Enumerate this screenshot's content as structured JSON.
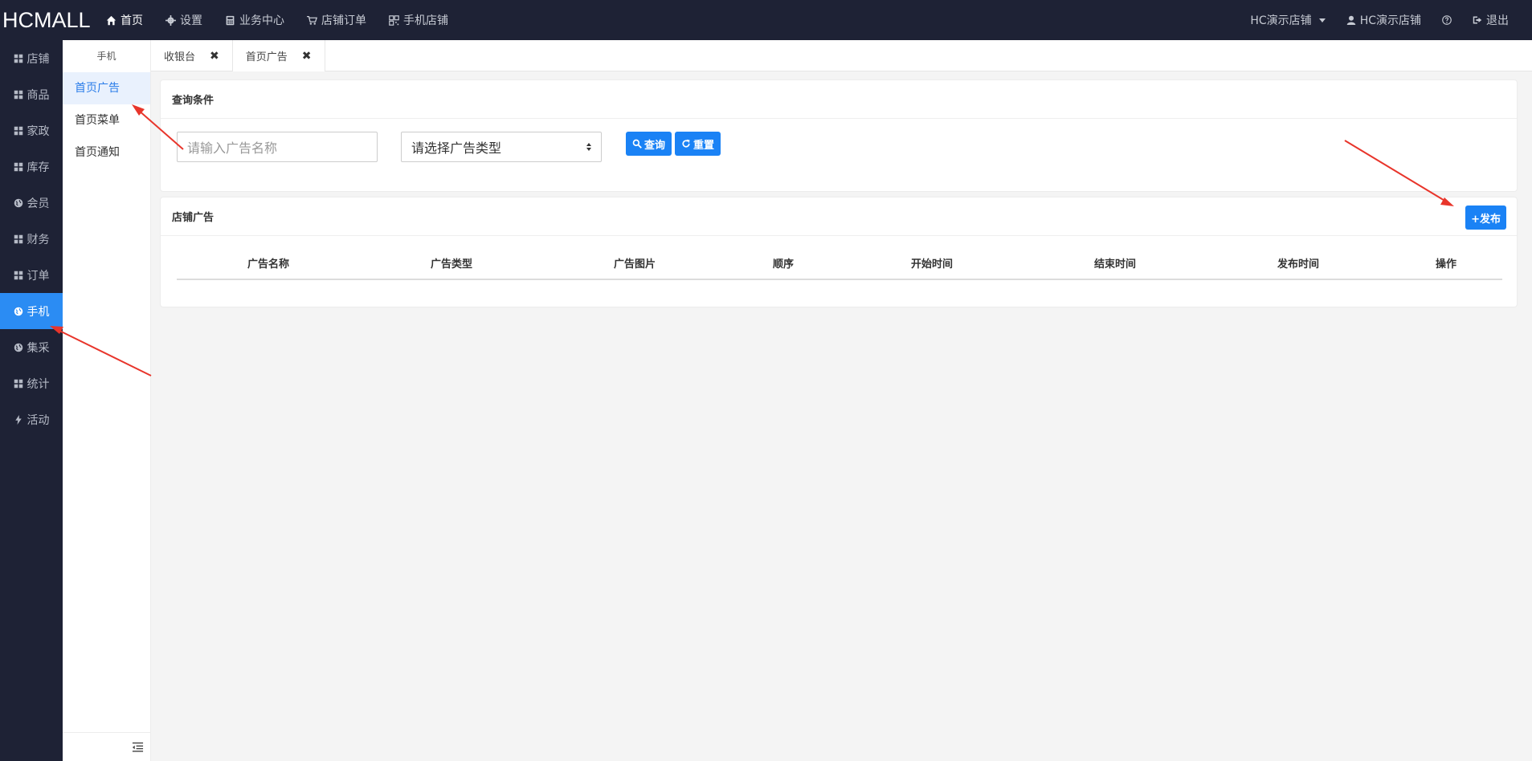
{
  "brand": "HCMALL",
  "topnav": [
    {
      "label": "首页",
      "icon": "home-icon"
    },
    {
      "label": "设置",
      "icon": "gear-icon"
    },
    {
      "label": "业务中心",
      "icon": "calculator-icon"
    },
    {
      "label": "店铺订单",
      "icon": "cart-icon"
    },
    {
      "label": "手机店铺",
      "icon": "qrcode-icon"
    }
  ],
  "topright": {
    "store_select": "HC演示店铺",
    "user": "HC演示店铺",
    "logout": "退出"
  },
  "sidebar": [
    {
      "label": "店铺",
      "icon": "grid-icon"
    },
    {
      "label": "商品",
      "icon": "grid-icon"
    },
    {
      "label": "家政",
      "icon": "grid-icon"
    },
    {
      "label": "库存",
      "icon": "grid-icon"
    },
    {
      "label": "会员",
      "icon": "globe-icon"
    },
    {
      "label": "财务",
      "icon": "grid-icon"
    },
    {
      "label": "订单",
      "icon": "grid-icon"
    },
    {
      "label": "手机",
      "icon": "globe-icon"
    },
    {
      "label": "集采",
      "icon": "globe-icon"
    },
    {
      "label": "统计",
      "icon": "grid-icon"
    },
    {
      "label": "活动",
      "icon": "bolt-icon"
    }
  ],
  "submenu": {
    "title": "手机",
    "items": [
      "首页广告",
      "首页菜单",
      "首页通知"
    ]
  },
  "tabs": [
    {
      "label": "收银台"
    },
    {
      "label": "首页广告"
    }
  ],
  "query": {
    "title": "查询条件",
    "name_placeholder": "请输入广告名称",
    "type_select": "请选择广告类型",
    "search_label": "查询",
    "reset_label": "重置"
  },
  "ads": {
    "title": "店铺广告",
    "publish_label": "+发布",
    "columns": [
      "广告名称",
      "广告类型",
      "广告图片",
      "顺序",
      "开始时间",
      "结束时间",
      "发布时间",
      "操作"
    ]
  },
  "colors": {
    "nav_bg": "#1e2235",
    "accent": "#2b8cf3",
    "button": "#1a82f5",
    "annotation_arrow": "#e8352b"
  }
}
